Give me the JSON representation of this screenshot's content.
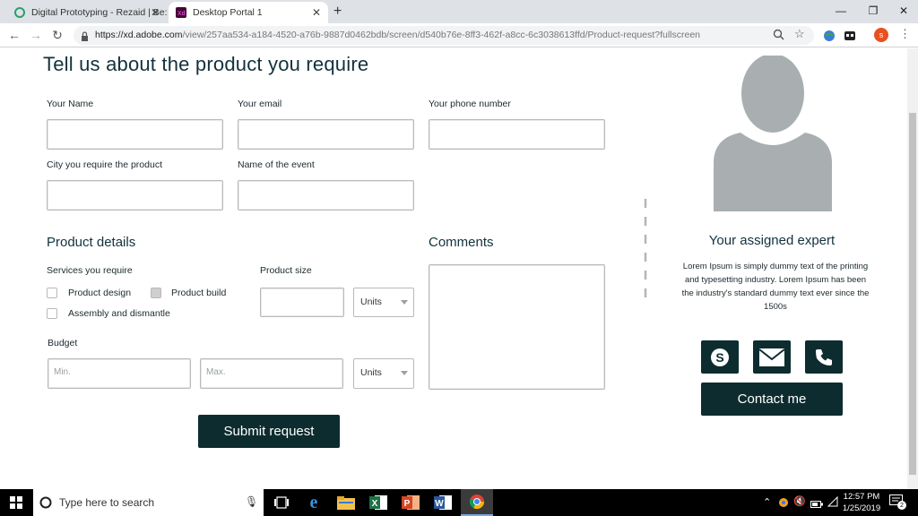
{
  "browser": {
    "tabs": [
      {
        "title": "Digital Prototyping - Rezaid | Be:",
        "active": false
      },
      {
        "title": "Desktop Portal 1",
        "active": true
      }
    ],
    "new_tab": "+",
    "url_host": "https://xd.adobe.com",
    "url_path": "/view/257aa534-a184-4520-a76b-9887d0462bdb/screen/d540b76e-8ff3-462f-a8cc-6c3038613ffd/Product-request?fullscreen",
    "profile_initial": "s"
  },
  "form": {
    "title": "Tell us about the product you require",
    "name_label": "Your Name",
    "email_label": "Your email",
    "phone_label": "Your phone number",
    "city_label": "City you require the product",
    "event_label": "Name of the event",
    "product_details": "Product details",
    "services_label": "Services you require",
    "services": [
      {
        "label": "Product design",
        "checked": false
      },
      {
        "label": "Product build",
        "checked": true
      },
      {
        "label": "Assembly and dismantle",
        "checked": false
      }
    ],
    "size_label": "Product size",
    "size_units": "Units",
    "budget_label": "Budget",
    "budget_min_placeholder": "Min.",
    "budget_max_placeholder": "Max.",
    "budget_units": "Units",
    "comments_label": "Comments",
    "submit": "Submit request"
  },
  "expert": {
    "title": "Your assigned expert",
    "description": "Lorem Ipsum is simply dummy text of the printing and typesetting industry. Lorem Ipsum has been the industry's standard dummy text ever since the 1500s",
    "contact_button": "Contact me",
    "contact_icons": [
      "skype-icon",
      "mail-icon",
      "phone-icon"
    ]
  },
  "taskbar": {
    "search_placeholder": "Type here to search",
    "time": "12:57 PM",
    "date": "1/25/2019",
    "notification_count": "2"
  },
  "colors": {
    "brand_dark": "#0d2c2f",
    "heading": "#12323d",
    "avatar_gray": "#a9aeb1"
  }
}
